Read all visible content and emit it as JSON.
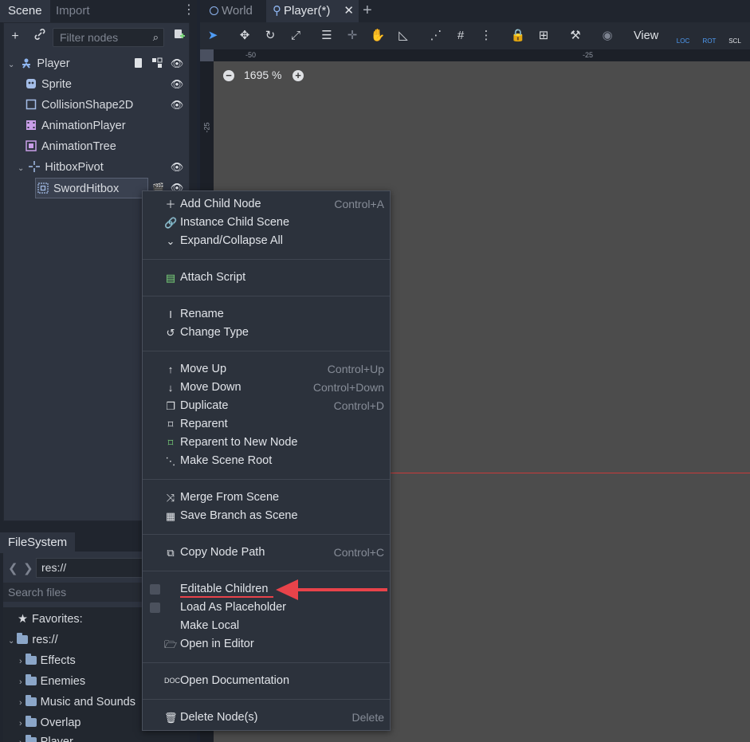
{
  "dock_tabs": {
    "scene": "Scene",
    "import": "Import"
  },
  "filter": {
    "placeholder": "Filter nodes"
  },
  "tree": {
    "player": "Player",
    "sprite": "Sprite",
    "collision": "CollisionShape2D",
    "animation_player": "AnimationPlayer",
    "animation_tree": "AnimationTree",
    "hitbox_pivot": "HitboxPivot",
    "sword_hitbox": "SwordHitbox"
  },
  "filesystem": {
    "tab": "FileSystem",
    "path": "res://",
    "search_placeholder": "Search files",
    "favorites": "Favorites:",
    "root": "res://",
    "folders": [
      "Effects",
      "Enemies",
      "Music and Sounds",
      "Overlap",
      "Player"
    ]
  },
  "editor_tabs": {
    "world": "World",
    "player": "Player(*)"
  },
  "toolbar": {
    "view": "View",
    "loc": "LOC",
    "rot": "ROT",
    "scl": "SCL"
  },
  "rulers": {
    "h1": "-50",
    "h2": "-25",
    "v1": "-25"
  },
  "zoom": {
    "level": "1695 %"
  },
  "menu": {
    "add_child": {
      "label": "Add Child Node",
      "shortcut": "Control+A"
    },
    "instance_child": {
      "label": "Instance Child Scene"
    },
    "expand_collapse": {
      "label": "Expand/Collapse All"
    },
    "attach_script": {
      "label": "Attach Script"
    },
    "rename": {
      "label": "Rename"
    },
    "change_type": {
      "label": "Change Type"
    },
    "move_up": {
      "label": "Move Up",
      "shortcut": "Control+Up"
    },
    "move_down": {
      "label": "Move Down",
      "shortcut": "Control+Down"
    },
    "duplicate": {
      "label": "Duplicate",
      "shortcut": "Control+D"
    },
    "reparent": {
      "label": "Reparent"
    },
    "reparent_new": {
      "label": "Reparent to New Node"
    },
    "make_root": {
      "label": "Make Scene Root"
    },
    "merge": {
      "label": "Merge From Scene"
    },
    "save_branch": {
      "label": "Save Branch as Scene"
    },
    "copy_path": {
      "label": "Copy Node Path",
      "shortcut": "Control+C"
    },
    "editable_children": {
      "label": "Editable Children"
    },
    "load_placeholder": {
      "label": "Load As Placeholder"
    },
    "make_local": {
      "label": "Make Local"
    },
    "open_editor": {
      "label": "Open in Editor"
    },
    "open_docs": {
      "label": "Open Documentation"
    },
    "delete": {
      "label": "Delete Node(s)",
      "shortcut": "Delete"
    }
  },
  "colors": {
    "accent": "#4f9cf5",
    "annotation": "#e8434a"
  }
}
